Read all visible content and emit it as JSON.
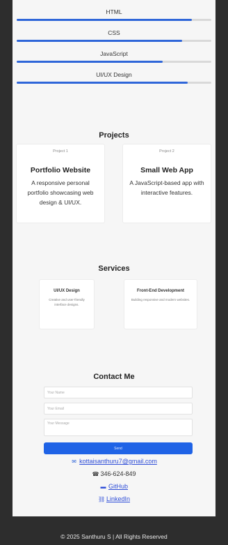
{
  "skills": [
    {
      "label": "HTML",
      "level": 0.9
    },
    {
      "label": "CSS",
      "level": 0.85
    },
    {
      "label": "JavaScript",
      "level": 0.75
    },
    {
      "label": "UI/UX Design",
      "level": 0.88
    }
  ],
  "projects": {
    "title": "Projects",
    "items": [
      {
        "img_alt": "Project 1",
        "title": "Portfolio Website",
        "desc": "A responsive personal portfolio showcasing web design & UI/UX."
      },
      {
        "img_alt": "Project 2",
        "title": "Small Web App",
        "desc": "A JavaScript-based app with interactive features."
      }
    ]
  },
  "services": {
    "title": "Services",
    "items": [
      {
        "title": "UI/UX Design",
        "desc": "Creative and user-friendly interface designs."
      },
      {
        "title": "Front-End Development",
        "desc": "Building responsive and modern websites."
      }
    ]
  },
  "contact": {
    "title": "Contact Me",
    "name_placeholder": "Your Name",
    "email_placeholder": "Your Email",
    "message_placeholder": "Your Message",
    "send_label": "Send",
    "email": "kottaisanthuru7@gmail.com",
    "phone": "346-624-849",
    "github": "GitHub",
    "linkedin": "LinkedIn"
  },
  "footer": "© 2025 Santhuru S | All Rights Reserved",
  "colors": {
    "accent": "#1f63e6",
    "background": "#2d2d2d",
    "panel": "#f6f6f6"
  }
}
